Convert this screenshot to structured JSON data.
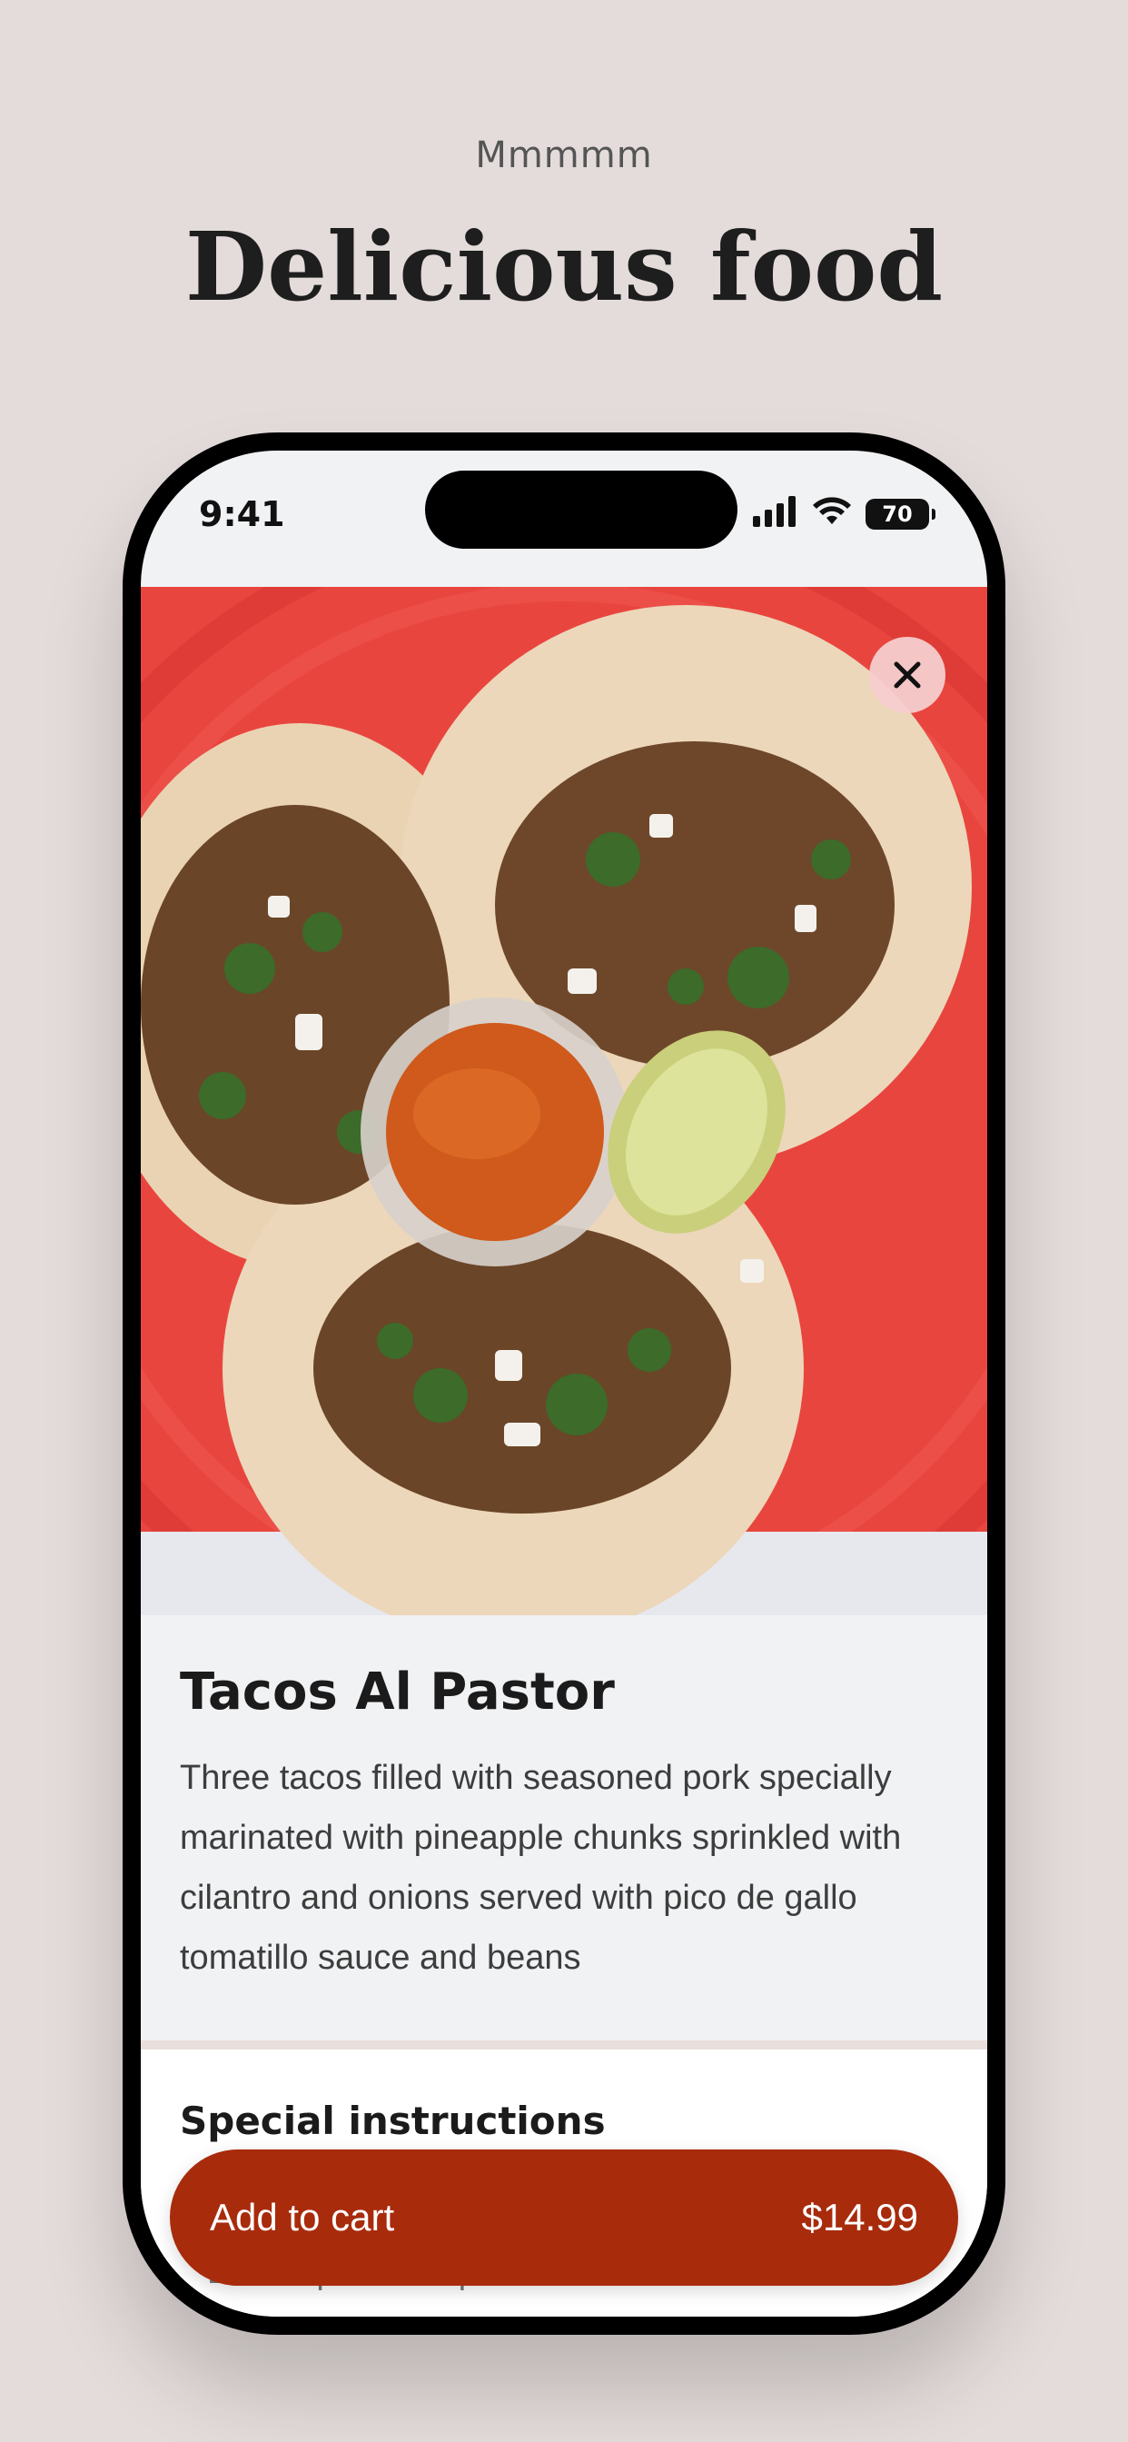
{
  "header": {
    "eyebrow": "Mmmmm",
    "headline": "Delicious food"
  },
  "status_bar": {
    "time": "9:41",
    "battery": "70",
    "icons": [
      "signal-icon",
      "wifi-icon",
      "battery-icon"
    ]
  },
  "product": {
    "image_alt": "tacos-photo",
    "title": "Tacos Al Pastor",
    "description": "Three tacos filled with seasoned pork specially marinated with pineapple chunks sprinkled with cilantro and onions served with pico de gallo tomatillo sauce and beans"
  },
  "instructions": {
    "label": "Special instructions",
    "placeholder": "Enter special requests"
  },
  "cart": {
    "label": "Add to cart",
    "price": "$14.99"
  },
  "colors": {
    "background": "#e4dcdb",
    "accent": "#a82b0c",
    "plate": "#e9453f"
  }
}
